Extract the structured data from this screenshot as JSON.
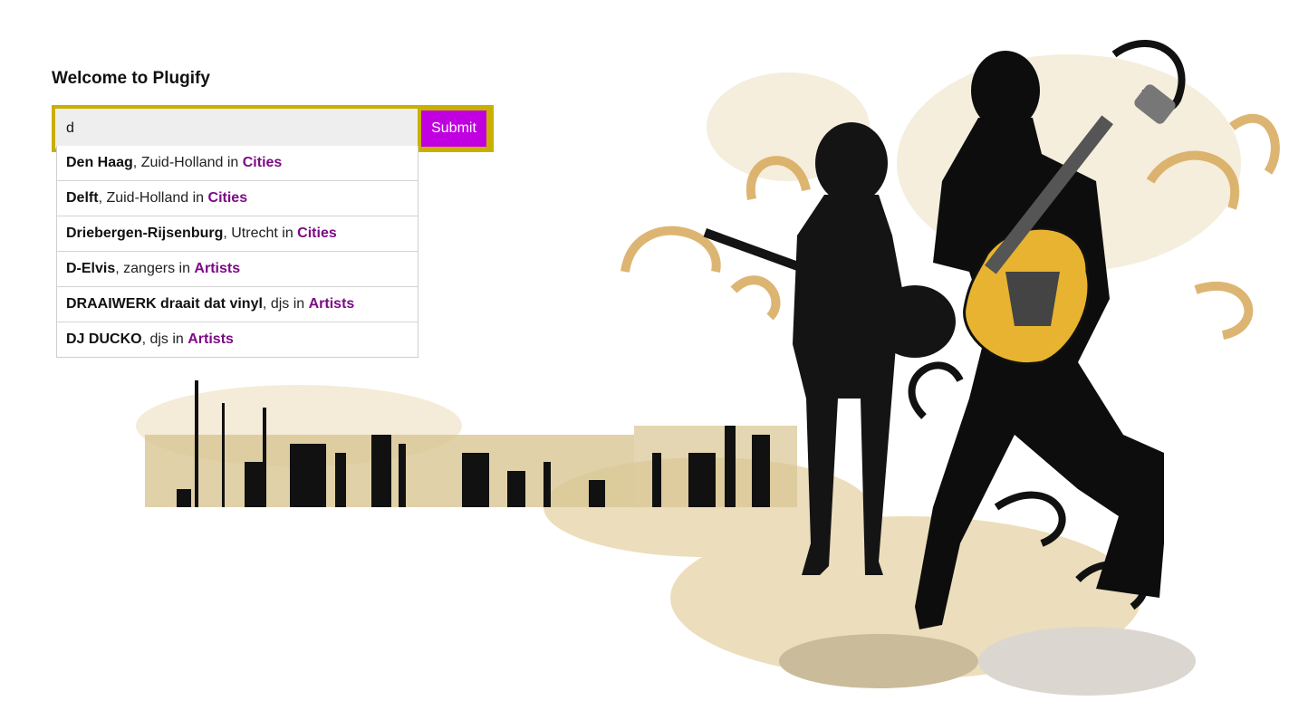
{
  "page": {
    "heading": "Welcome to Plugify"
  },
  "search": {
    "value": "d",
    "submit_label": "Submit"
  },
  "suggestions": [
    {
      "name": "Den Haag",
      "sep": ", ",
      "region": "Zuid-Holland",
      "in": " in ",
      "category": "Cities"
    },
    {
      "name": "Delft",
      "sep": ", ",
      "region": "Zuid-Holland",
      "in": " in ",
      "category": "Cities"
    },
    {
      "name": "Driebergen-Rijsenburg",
      "sep": ", ",
      "region": "Utrecht",
      "in": " in ",
      "category": "Cities"
    },
    {
      "name": "D-Elvis",
      "sep": ", ",
      "region": "zangers",
      "in": " in ",
      "category": "Artists"
    },
    {
      "name": "DRAAIWERK draait dat vinyl",
      "sep": ", ",
      "region": "djs",
      "in": " in ",
      "category": "Artists"
    },
    {
      "name": "DJ DUCKO",
      "sep": ", ",
      "region": "djs",
      "in": " in ",
      "category": "Artists"
    }
  ],
  "colors": {
    "accent_border": "#c9b000",
    "submit_bg": "#c000e0",
    "category_text": "#7d0a86"
  },
  "artwork": {
    "icon": "guitarist-duo-illustration"
  }
}
